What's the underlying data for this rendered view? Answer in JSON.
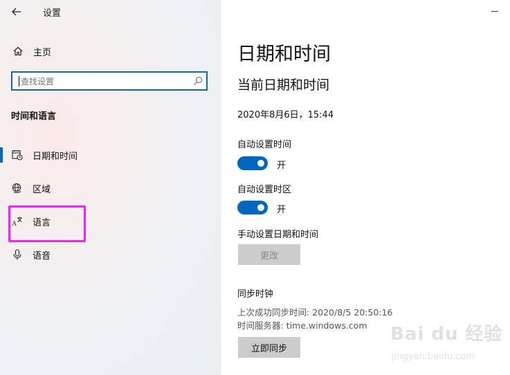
{
  "window": {
    "title": "设置"
  },
  "sidebar": {
    "home_label": "主页",
    "search_placeholder": "查找设置",
    "section_title": "时间和语言",
    "items": [
      {
        "label": "日期和时间",
        "icon": "calendar-clock-icon",
        "active": true
      },
      {
        "label": "区域",
        "icon": "globe-region-icon",
        "active": false
      },
      {
        "label": "语言",
        "icon": "language-icon",
        "active": false
      },
      {
        "label": "语音",
        "icon": "microphone-icon",
        "active": false
      }
    ]
  },
  "main": {
    "page_title": "日期和时间",
    "sub_title": "当前日期和时间",
    "current_datetime": "2020年8月6日，15:44",
    "auto_time": {
      "label": "自动设置时间",
      "state": "开",
      "on": true
    },
    "auto_timezone": {
      "label": "自动设置时区",
      "state": "开",
      "on": true
    },
    "manual": {
      "label": "手动设置日期和时间",
      "button": "更改",
      "enabled": false
    },
    "sync": {
      "title": "同步时钟",
      "last_sync": "上次成功同步时间: 2020/8/5 20:50:16",
      "server": "时间服务器: time.windows.com",
      "button": "立即同步"
    }
  },
  "watermark": {
    "main": "Bai du 经验",
    "sub": "jingyan.baidu.com"
  },
  "colors": {
    "accent": "#0067c0",
    "search_border": "#0a66c2",
    "highlight": "#ff1aff",
    "button_bg": "#cccccc"
  }
}
